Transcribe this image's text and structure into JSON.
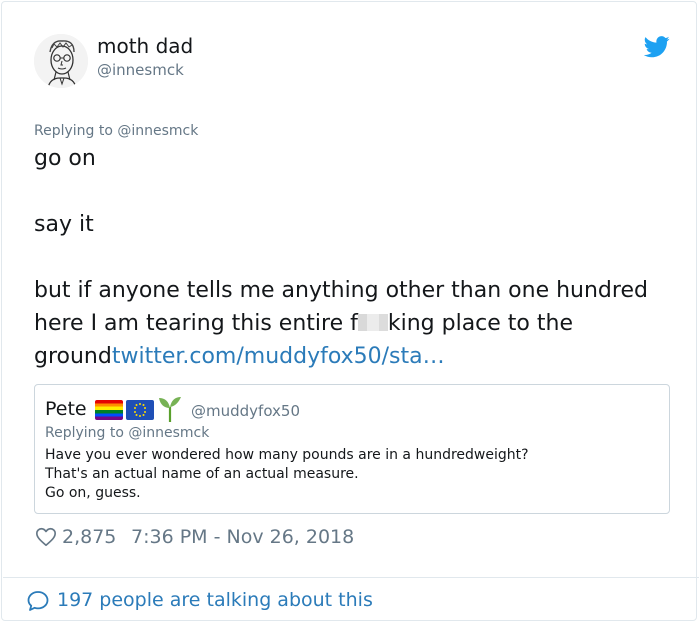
{
  "author": {
    "display_name": "moth dad",
    "handle": "@innesmck",
    "avatar_icon": "sketch-portrait-avatar"
  },
  "reply_context": "Replying to @innesmck",
  "tweet": {
    "line1": "go on",
    "line2": "say it",
    "line3_before_censor": "but if anyone tells me anything other than one hundred here I am tearing this entire f",
    "line3_after_censor": "king place to the ground",
    "link_text": "twitter.com/muddyfox50/sta…"
  },
  "quoted_tweet": {
    "name": "Pete",
    "handle": "@muddyfox50",
    "emoji_icons": [
      "rainbow-flag-icon",
      "eu-flag-icon",
      "seedling-icon"
    ],
    "reply_context": "Replying to @innesmck",
    "body": [
      "Have you ever wondered how many pounds are in a hundredweight?",
      "That's an actual name of an actual measure.",
      "Go on, guess."
    ]
  },
  "meta": {
    "likes": "2,875",
    "timestamp": "7:36 PM - Nov 26, 2018"
  },
  "footer": {
    "talking": "197 people are talking about this"
  },
  "colors": {
    "link": "#2b7bb9",
    "secondary_text": "#657786",
    "twitter_blue": "#1da1f2",
    "border": "#e1e8ed"
  }
}
